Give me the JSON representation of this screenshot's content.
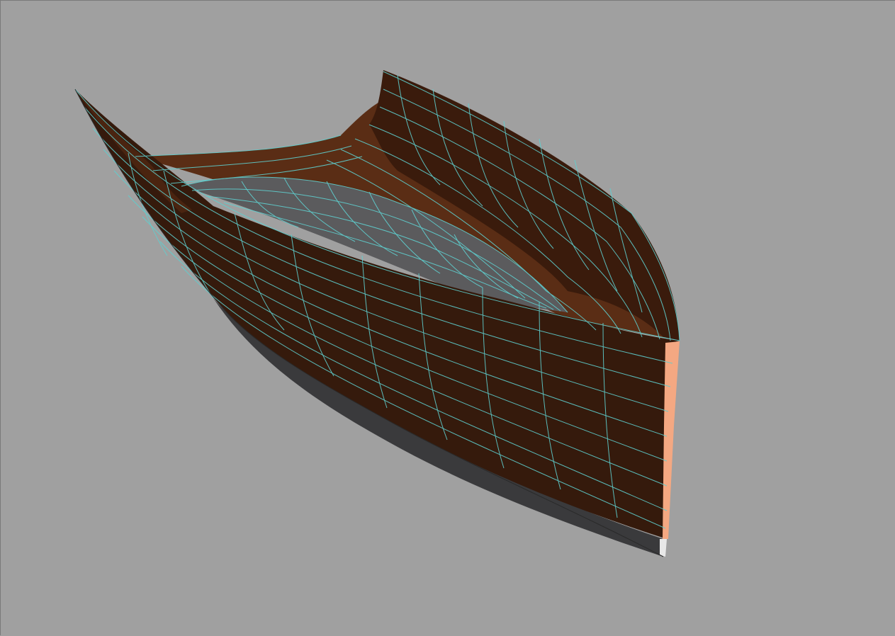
{
  "viewport": {
    "background_color": "#a0a0a0",
    "mesh": {
      "object": "boat-hull",
      "outer_surface_color": "#351a0c",
      "inner_surface_color": "#5a2d15",
      "deck_surface_color": "#5b5b5d",
      "bottom_strip_color": "#3a3a3c",
      "transom_edge_color": "#f4a882",
      "wireframe_color": "#5fcfcf"
    }
  }
}
